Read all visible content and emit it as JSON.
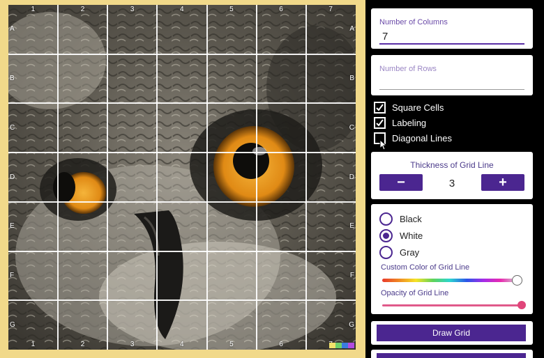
{
  "grid": {
    "columns": [
      "1",
      "2",
      "3",
      "4",
      "5",
      "6",
      "7"
    ],
    "rows": [
      "A",
      "B",
      "C",
      "D",
      "E",
      "F",
      "G"
    ]
  },
  "inputs": {
    "columns_label": "Number of Columns",
    "columns_value": "7",
    "rows_label": "Number of Rows",
    "rows_value": ""
  },
  "options": {
    "square_cells": {
      "label": "Square Cells",
      "checked": true
    },
    "labeling": {
      "label": "Labeling",
      "checked": true
    },
    "diagonal_lines": {
      "label": "Diagonal Lines",
      "checked": false
    }
  },
  "thickness": {
    "title": "Thickness of Grid Line",
    "minus": "−",
    "plus": "+",
    "value": "3"
  },
  "color": {
    "options": [
      "Black",
      "White",
      "Gray"
    ],
    "selected": "White",
    "custom_label": "Custom Color of Grid Line",
    "custom_value": 1.0,
    "opacity_label": "Opacity of Grid Line",
    "opacity_value": 1.0
  },
  "actions": {
    "draw_grid": "Draw Grid"
  },
  "colors": {
    "accent": "#4b2690",
    "frame": "#f1d98a",
    "slider_pink": "#e0457a"
  }
}
